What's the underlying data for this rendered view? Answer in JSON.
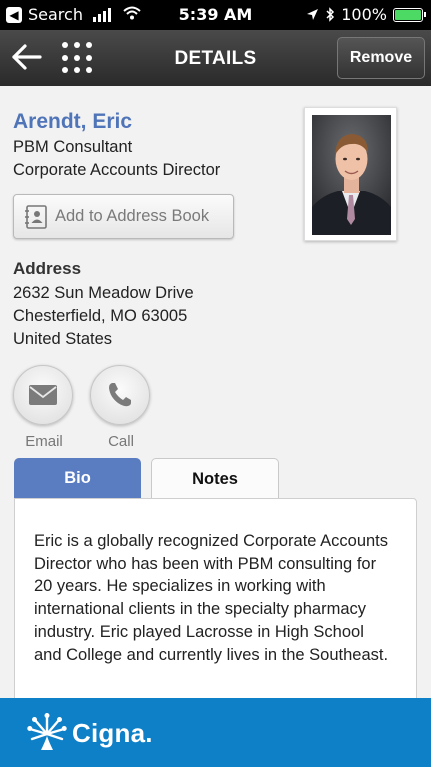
{
  "status_bar": {
    "back_app_label": "Search",
    "time": "5:39 AM",
    "battery_percent": "100%",
    "battery_level": 1.0
  },
  "nav": {
    "title": "DETAILS",
    "remove_label": "Remove"
  },
  "contact": {
    "name": "Arendt, Eric",
    "role": "PBM Consultant",
    "title": "Corporate Accounts Director",
    "add_to_address_book_label": "Add to Address Book"
  },
  "address": {
    "heading": "Address",
    "line1": "2632 Sun Meadow Drive",
    "line2": "Chesterfield, MO 63005",
    "line3": "United States"
  },
  "actions": {
    "email_label": "Email",
    "call_label": "Call"
  },
  "tabs": {
    "bio_label": "Bio",
    "notes_label": "Notes",
    "active": "Bio"
  },
  "bio": {
    "text": "Eric is a globally recognized Corporate Accounts Director  who has been with PBM consulting for 20 years. He specializes in working with international clients in the specialty pharmacy industry. Eric played Lacrosse in High School and College and currently lives in the Southeast."
  },
  "footer": {
    "brand": "Cigna."
  },
  "colors": {
    "accent": "#4f74b8",
    "tab_active": "#5a7cc0",
    "footer": "#0e80c7",
    "nav_bar": "#333333"
  }
}
